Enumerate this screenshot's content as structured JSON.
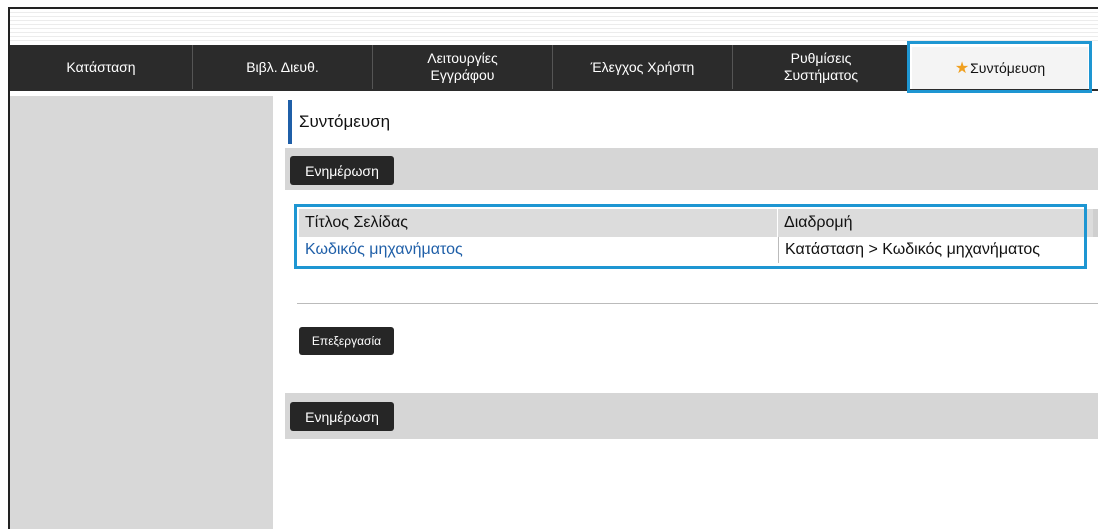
{
  "tabs": [
    {
      "label": "Κατάσταση"
    },
    {
      "label": "Βιβλ. Διευθ."
    },
    {
      "label": "Λειτουργίες Εγγράφου",
      "line1": "Λειτουργίες",
      "line2": "Εγγράφου"
    },
    {
      "label": "Έλεγχος Χρήστη"
    },
    {
      "label": "Ρυθμίσεις Συστήματος",
      "line1": "Ρυθμίσεις",
      "line2": "Συστήματος"
    },
    {
      "label": "Συντόμευση",
      "icon": "star-icon",
      "active": true
    }
  ],
  "page": {
    "title": "Συντόμευση"
  },
  "buttons": {
    "update_top": "Ενημέρωση",
    "edit": "Επεξεργασία",
    "update_bottom": "Ενημέρωση"
  },
  "table": {
    "columns": [
      "Τίτλος Σελίδας",
      "Διαδρομή"
    ],
    "rows": [
      {
        "title": "Κωδικός μηχανήματος",
        "path": "Κατάσταση >  Κωδικός μηχανήματος"
      }
    ]
  },
  "colors": {
    "tab_bg": "#2b2b2b",
    "highlight": "#1e96d2",
    "link": "#1f5fa8",
    "star": "#f0a020"
  }
}
